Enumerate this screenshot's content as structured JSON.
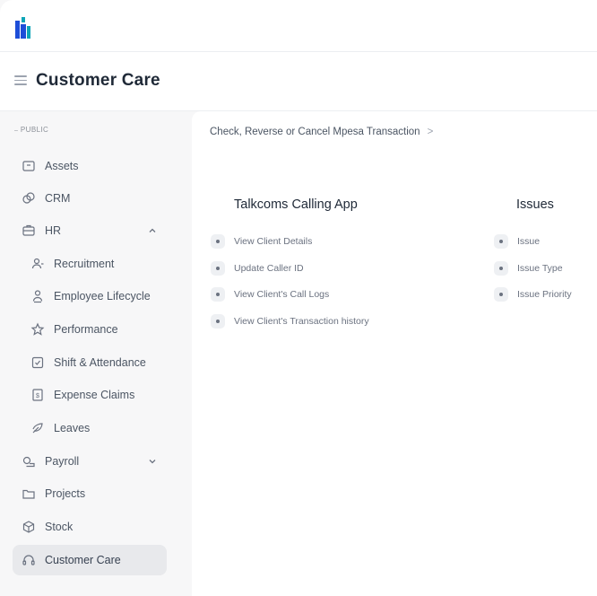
{
  "colors": {
    "logo_blue": "#1d4ed8",
    "logo_teal": "#0ea5b7",
    "active_bg": "#e8e9ec"
  },
  "header": {
    "logo_icon": "company-logo-icon",
    "menu_icon": "hamburger-menu-icon",
    "title": "Customer Care"
  },
  "sidebar": {
    "section_label": "PUBLIC",
    "items": [
      {
        "label": "Assets",
        "icon": "asset-icon"
      },
      {
        "label": "CRM",
        "icon": "crm-icon"
      },
      {
        "label": "HR",
        "icon": "hr-icon",
        "expanded": true
      },
      {
        "label": "Recruitment",
        "icon": "recruitment-icon"
      },
      {
        "label": "Employee Lifecycle",
        "icon": "employee-icon"
      },
      {
        "label": "Performance",
        "icon": "star-icon"
      },
      {
        "label": "Shift & Attendance",
        "icon": "attendance-icon"
      },
      {
        "label": "Expense Claims",
        "icon": "expense-icon"
      },
      {
        "label": "Leaves",
        "icon": "leaves-icon"
      },
      {
        "label": "Payroll",
        "icon": "payroll-icon",
        "expanded": false
      },
      {
        "label": "Projects",
        "icon": "folder-icon"
      },
      {
        "label": "Stock",
        "icon": "stock-icon"
      },
      {
        "label": "Customer Care",
        "icon": "headset-icon",
        "active": true
      }
    ]
  },
  "main": {
    "breadcrumb": "Check, Reverse or Cancel Mpesa Transaction",
    "breadcrumb_sep": ">",
    "cards": [
      {
        "title": "Talkcoms Calling App",
        "links": [
          "View Client Details",
          "Update Caller ID",
          "View Client's Call Logs",
          "View Client's Transaction history"
        ]
      },
      {
        "title": "Issues",
        "links": [
          "Issue",
          "Issue Type",
          "Issue Priority"
        ]
      }
    ]
  }
}
